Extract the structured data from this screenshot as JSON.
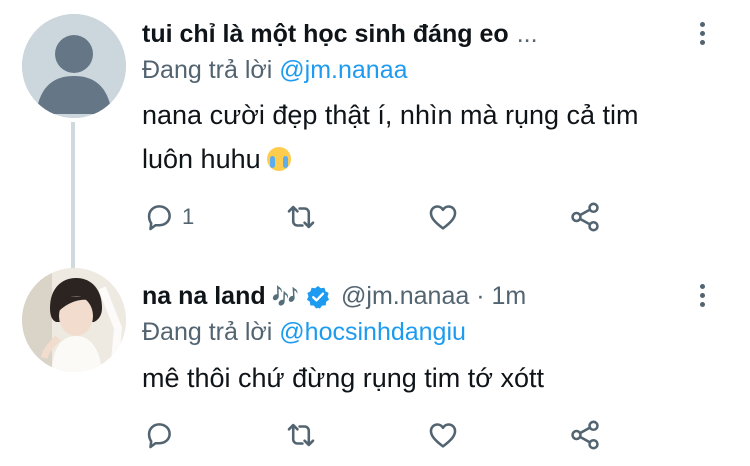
{
  "tweets": [
    {
      "display_name": "tui chỉ là một học sinh đáng eo",
      "name_ellipsis": "...",
      "reply_prefix": "Đang trả lời",
      "reply_to": "@jm.nanaa",
      "text_line1": "nana cười đẹp thật í, nhìn mà rụng cả tim",
      "text_line2": "luôn huhu",
      "emoji": "loudly-crying-face",
      "reply_count": "1",
      "avatar": "default-avatar-icon"
    },
    {
      "display_name": "na na land",
      "name_symbol": "🎶",
      "verified_color": "#1d9bf0",
      "handle_meta": "@jm.nanaa · 1m",
      "reply_prefix": "Đang trả lời",
      "reply_to": "@hocsinhdangiu",
      "text_line1": "mê thôi chứ đừng rụng tim tớ xótt",
      "avatar": "user-photo-avatar"
    }
  ],
  "colors": {
    "text": "#0f1419",
    "secondary": "#536471",
    "link": "#1d9bf0",
    "thread_line": "#cfd9de"
  },
  "icons": [
    "reply-icon",
    "retweet-icon",
    "like-icon",
    "share-icon",
    "more-icon",
    "verified-icon"
  ]
}
